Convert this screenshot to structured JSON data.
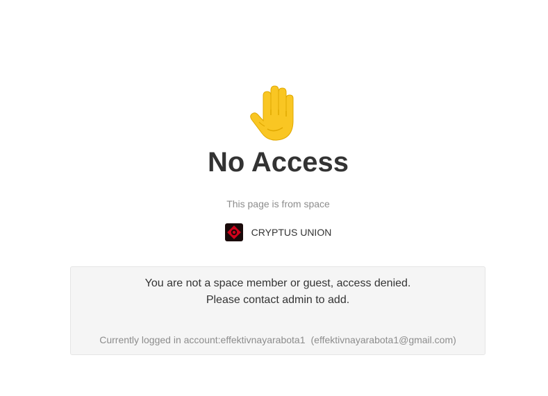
{
  "hero": {
    "icon": "raised-hand-icon",
    "title": "No Access",
    "subtitle": "This page is from space"
  },
  "space": {
    "logo_icon": "cryptus-union-logo-icon",
    "name": "CRYPTUS UNION"
  },
  "notice": {
    "line1": "You are not a space member or guest, access denied.",
    "line2": "Please contact admin to add.",
    "account_label": "Currently logged in account:",
    "account_name": "effektivnayarabota1",
    "account_email": "(effektivnayarabota1@gmail.com)"
  },
  "colors": {
    "title": "#333333",
    "muted": "#8c8c8c",
    "notice_bg": "#f5f5f5",
    "hand": "#f9c623",
    "logo_bg": "#1a0a0a",
    "logo_accent": "#d0021b"
  }
}
